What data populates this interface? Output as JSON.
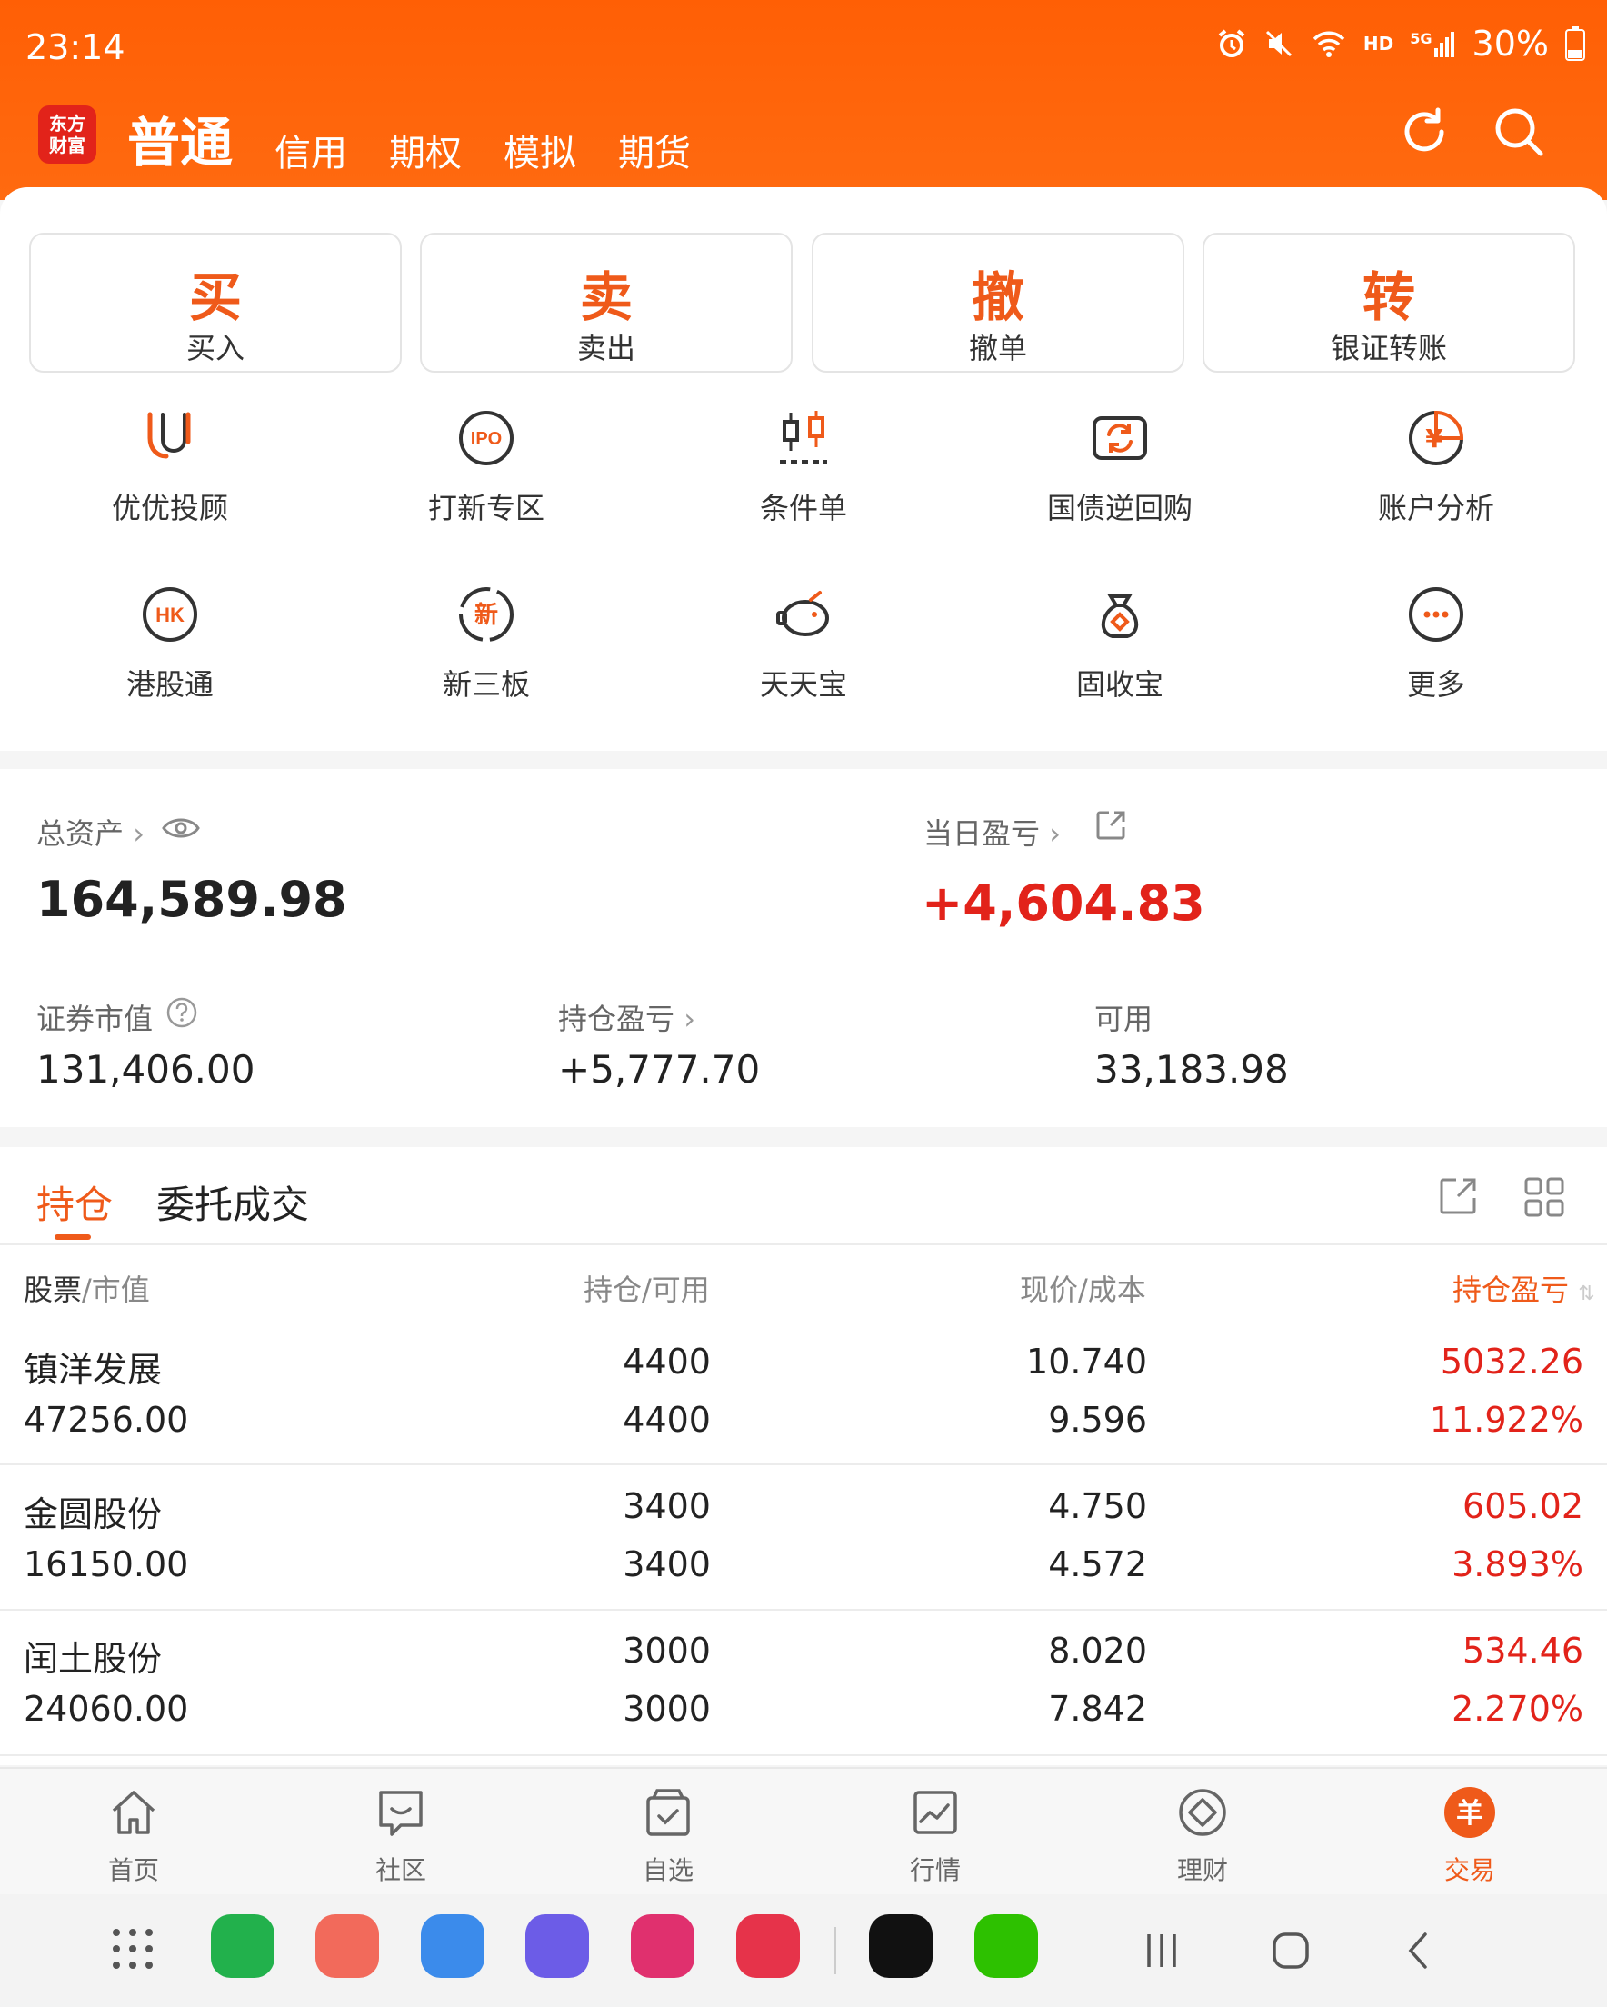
{
  "status_bar": {
    "time": "23:14",
    "battery": "30%",
    "network": "5G",
    "hd": "HD"
  },
  "header": {
    "logo_text_1": "东方",
    "logo_text_2": "财富",
    "tabs": [
      {
        "label": "普通",
        "active": true
      },
      {
        "label": "信用",
        "active": false
      },
      {
        "label": "期权",
        "active": false
      },
      {
        "label": "模拟",
        "active": false
      },
      {
        "label": "期货",
        "active": false
      }
    ],
    "icons": [
      "refresh-icon",
      "search-icon"
    ]
  },
  "actions": [
    {
      "glyph": "买",
      "label": "买入"
    },
    {
      "glyph": "卖",
      "label": "卖出"
    },
    {
      "glyph": "撤",
      "label": "撤单"
    },
    {
      "glyph": "转",
      "label": "银证转账"
    }
  ],
  "features": [
    {
      "label": "优优投顾",
      "icon": "uu-advisor-icon"
    },
    {
      "label": "打新专区",
      "icon": "ipo-icon"
    },
    {
      "label": "条件单",
      "icon": "conditional-order-icon"
    },
    {
      "label": "国债逆回购",
      "icon": "reverse-repo-icon"
    },
    {
      "label": "账户分析",
      "icon": "account-analysis-icon"
    },
    {
      "label": "港股通",
      "icon": "hk-icon"
    },
    {
      "label": "新三板",
      "icon": "new-third-board-icon"
    },
    {
      "label": "天天宝",
      "icon": "piggy-bank-icon"
    },
    {
      "label": "固收宝",
      "icon": "money-bag-icon"
    },
    {
      "label": "更多",
      "icon": "more-icon"
    }
  ],
  "icon_texts": {
    "ipo": "IPO",
    "hk": "HK",
    "xin": "新",
    "yen": "¥"
  },
  "assets": {
    "total_label": "总资产",
    "total_value": "164,589.98",
    "daily_pnl_label": "当日盈亏",
    "daily_pnl_value": "+4,604.83",
    "market_value_label": "证券市值",
    "market_value": "131,406.00",
    "position_pnl_label": "持仓盈亏",
    "position_pnl": "+5,777.70",
    "available_label": "可用",
    "available": "33,183.98"
  },
  "positions": {
    "tabs": [
      "持仓",
      "委托成交"
    ],
    "headers": {
      "stock": "股票",
      "stock_suffix": "/市值",
      "qty": "持仓/可用",
      "price": "现价/成本",
      "pnl": "持仓盈亏"
    },
    "rows": [
      {
        "name": "镇洋发展",
        "market_value": "47256.00",
        "qty": "4400",
        "available": "4400",
        "price": "10.740",
        "cost": "9.596",
        "pnl": "5032.26",
        "pnl_pct": "11.922%"
      },
      {
        "name": "金圆股份",
        "market_value": "16150.00",
        "qty": "3400",
        "available": "3400",
        "price": "4.750",
        "cost": "4.572",
        "pnl": "605.02",
        "pnl_pct": "3.893%"
      },
      {
        "name": "闰土股份",
        "market_value": "24060.00",
        "qty": "3000",
        "available": "3000",
        "price": "8.020",
        "cost": "7.842",
        "pnl": "534.46",
        "pnl_pct": "2.270%"
      }
    ]
  },
  "bottom_nav": [
    {
      "label": "首页",
      "icon": "home-icon"
    },
    {
      "label": "社区",
      "icon": "community-icon"
    },
    {
      "label": "自选",
      "icon": "watchlist-icon"
    },
    {
      "label": "行情",
      "icon": "market-icon"
    },
    {
      "label": "理财",
      "icon": "wealth-icon"
    },
    {
      "label": "交易",
      "icon": "trade-icon",
      "active": true
    }
  ],
  "trade_glyph": "羊",
  "colors": {
    "brand": "#ff6010",
    "accent": "#ef5a1a",
    "red": "#e2231a"
  }
}
